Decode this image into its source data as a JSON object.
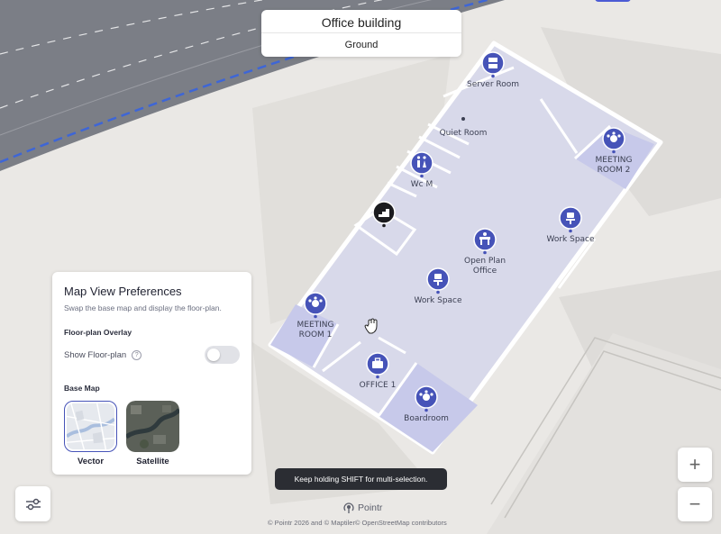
{
  "building": {
    "name": "Office building",
    "level": "Ground"
  },
  "rooms": [
    {
      "id": "server-room",
      "lines": [
        "Server Room"
      ],
      "icon": "server-icon"
    },
    {
      "id": "quiet-room",
      "lines": [
        "Quiet Room"
      ],
      "icon": "dot-icon"
    },
    {
      "id": "meeting-room-2",
      "lines": [
        "MEETING",
        "ROOM 2"
      ],
      "icon": "meeting-icon"
    },
    {
      "id": "wc-m",
      "lines": [
        "Wc M"
      ],
      "icon": "restroom-icon"
    },
    {
      "id": "work-space-1",
      "lines": [
        "Work Space"
      ],
      "icon": "chair-icon"
    },
    {
      "id": "open-plan-office",
      "lines": [
        "Open Plan",
        "Office"
      ],
      "icon": "desk-icon"
    },
    {
      "id": "work-space-2",
      "lines": [
        "Work Space"
      ],
      "icon": "chair-icon"
    },
    {
      "id": "meeting-room-1",
      "lines": [
        "MEETING",
        "ROOM 1"
      ],
      "icon": "meeting-icon"
    },
    {
      "id": "office-1",
      "lines": [
        "OFFICE 1"
      ],
      "icon": "briefcase-icon"
    },
    {
      "id": "boardroom",
      "lines": [
        "Boardroom"
      ],
      "icon": "meeting-icon"
    },
    {
      "id": "stairs",
      "lines": [],
      "icon": "stairs-icon"
    }
  ],
  "preferences": {
    "title": "Map View Preferences",
    "subtitle": "Swap the base map and display the floor-plan.",
    "overlay_section": "Floor-plan Overlay",
    "show_floorplan_label": "Show Floor-plan",
    "show_floorplan_on": false,
    "base_map_section": "Base Map",
    "base_maps": [
      {
        "label": "Vector",
        "selected": true
      },
      {
        "label": "Satellite",
        "selected": false
      }
    ]
  },
  "toast": "Keep holding SHIFT for multi-selection.",
  "brand": "Pointr",
  "attribution": "© Pointr 2026 and © Maptiler© OpenStreetMap contributors",
  "zoom": {
    "in": "+",
    "out": "−"
  },
  "colors": {
    "accent": "#4653b8",
    "room_fill": "#d6d7ea",
    "highlight_room": "#c7c9ea",
    "toast_bg": "#2b2d33"
  }
}
